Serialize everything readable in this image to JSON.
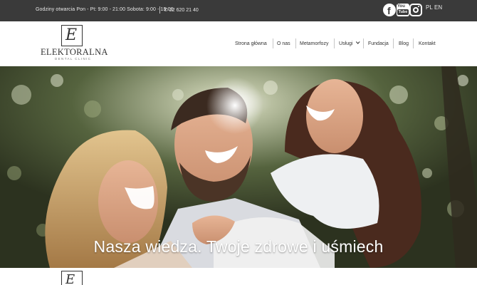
{
  "topbar": {
    "hours": "Godziny otwarcia Pon - Pt: 9:00 - 21:00 Sobota: 9:00 - 15:00",
    "phone_icon": "phone-icon",
    "phone": "22 620 21 40",
    "social": {
      "facebook": "f",
      "youtube_top": "You",
      "youtube_bottom": "Tube",
      "instagram": "instagram-icon"
    },
    "lang_pl": "PL",
    "lang_en": "EN"
  },
  "brand": {
    "monogram": "E",
    "name": "ELEKTORALNA",
    "tagline": "DENTAL CLINIC"
  },
  "nav": {
    "items": [
      {
        "label": "Strona główna"
      },
      {
        "label": "O nas"
      },
      {
        "label": "Metamorfozy"
      },
      {
        "label": "Usługi"
      },
      {
        "label": "Fundacja"
      },
      {
        "label": "Blog"
      },
      {
        "label": "Kontakt"
      }
    ],
    "dropdown_icon": "chevron-down-icon"
  },
  "hero": {
    "title": "Nasza wiedza. Twoje zdrowe i uśmiech"
  },
  "colors": {
    "topbar_bg": "#3a3a3a",
    "text_dark": "#333333",
    "hero_text": "#ffffff"
  }
}
